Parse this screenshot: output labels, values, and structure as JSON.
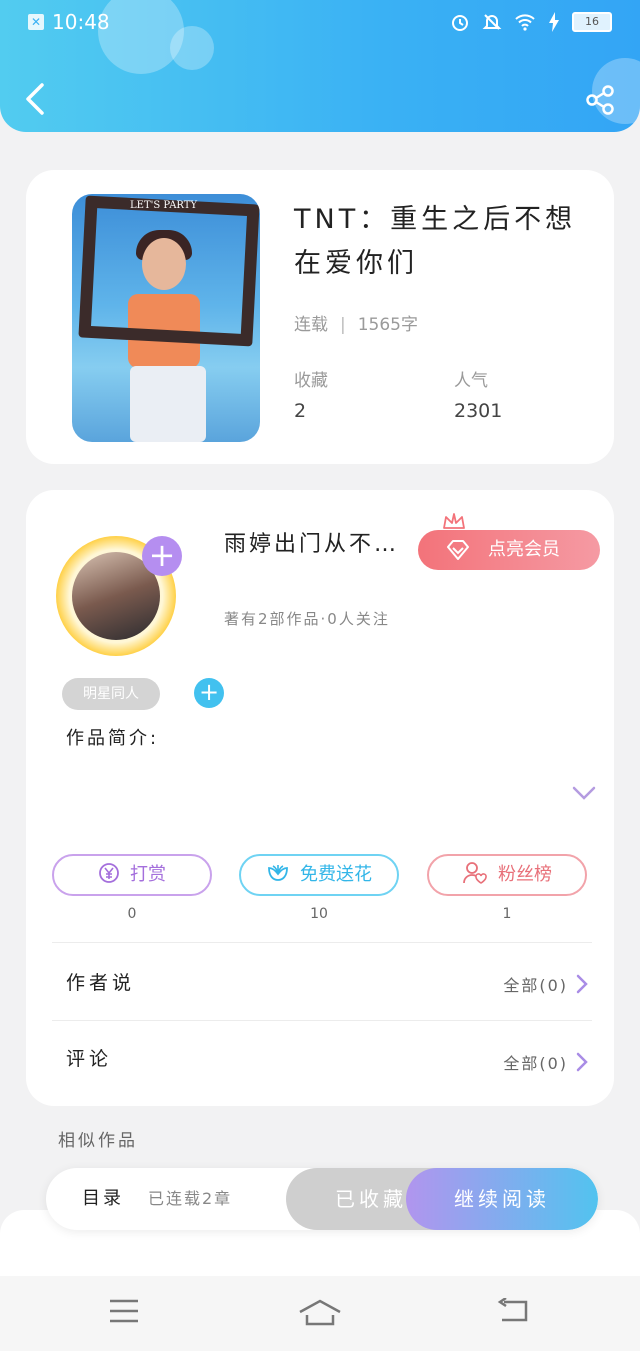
{
  "status_bar": {
    "time": "10:48",
    "battery": "16"
  },
  "book": {
    "title": "TNT：重生之后不想在爱你们",
    "status": "连载",
    "word_count": "1565字",
    "favorites_label": "收藏",
    "favorites_value": "2",
    "popularity_label": "人气",
    "popularity_value": "2301",
    "cover_frame_text": "LET'S PARTY"
  },
  "author": {
    "name": "雨婷出门从不…",
    "vip_button": "点亮会员",
    "summary": "著有2部作品·0人关注",
    "tag": "明星同人",
    "intro_label": "作品简介:"
  },
  "actions": [
    {
      "label": "打赏",
      "count": "0"
    },
    {
      "label": "免费送花",
      "count": "10"
    },
    {
      "label": "粉丝榜",
      "count": "1"
    }
  ],
  "rows": {
    "author_says": {
      "title": "作者说",
      "right": "全部(0)"
    },
    "comments": {
      "title": "评论",
      "right": "全部(0)"
    }
  },
  "similar_label": "相似作品",
  "bottom_bar": {
    "toc": "目录",
    "chapters": "已连载2章",
    "favorited": "已收藏",
    "continue_reading": "继续阅读"
  },
  "colors": {
    "header_start": "#52ccf0",
    "header_end": "#33a5f5",
    "vip": "#f3737a",
    "reward": "#a46fdc",
    "flower": "#33b6e8",
    "fans": "#e87079"
  }
}
